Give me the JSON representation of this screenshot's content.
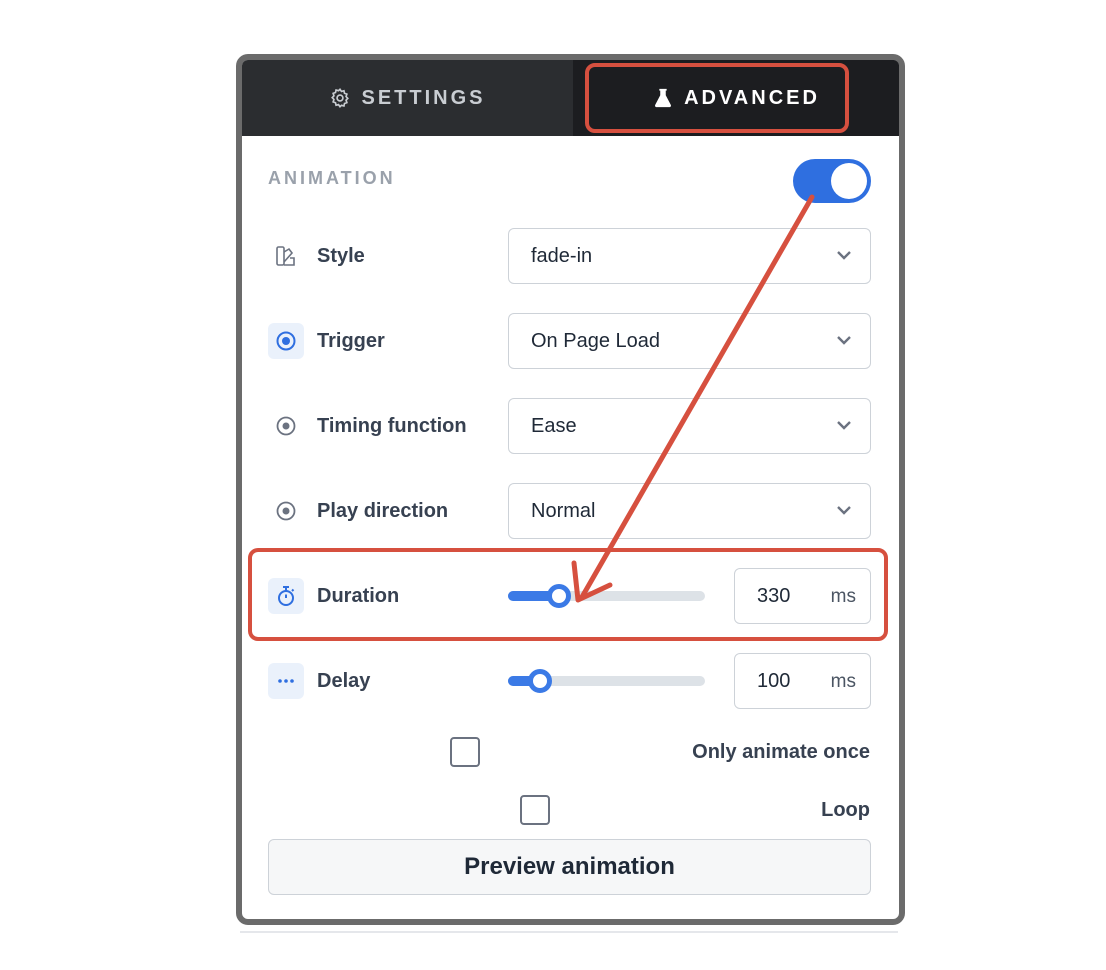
{
  "tabs": [
    {
      "label": "SETTINGS",
      "icon": "gear-icon",
      "active": false
    },
    {
      "label": "ADVANCED",
      "icon": "flask-icon",
      "active": true
    }
  ],
  "section": {
    "label": "ANIMATION",
    "enabled": true
  },
  "rows": {
    "style": {
      "label": "Style",
      "value": "fade-in",
      "icon": "style-icon"
    },
    "trigger": {
      "label": "Trigger",
      "value": "On Page Load",
      "icon": "target-icon"
    },
    "timing": {
      "label": "Timing function",
      "value": "Ease",
      "icon": "radio-dot-icon"
    },
    "direction": {
      "label": "Play direction",
      "value": "Normal",
      "icon": "radio-dot-icon"
    },
    "duration": {
      "label": "Duration",
      "value": "330",
      "unit": "ms",
      "slider_fraction": 0.2,
      "icon": "stopwatch-icon"
    },
    "delay": {
      "label": "Delay",
      "value": "100",
      "unit": "ms",
      "slider_fraction": 0.1,
      "icon": "dots-icon"
    }
  },
  "checkboxes": {
    "only_once": {
      "label": "Only animate once",
      "checked": false
    },
    "loop": {
      "label": "Loop",
      "checked": false
    }
  },
  "preview_button": {
    "label": "Preview animation"
  },
  "colors": {
    "accent": "#3b7ae6",
    "annotation": "#d6503f",
    "tabbar": "#2b2d30"
  }
}
